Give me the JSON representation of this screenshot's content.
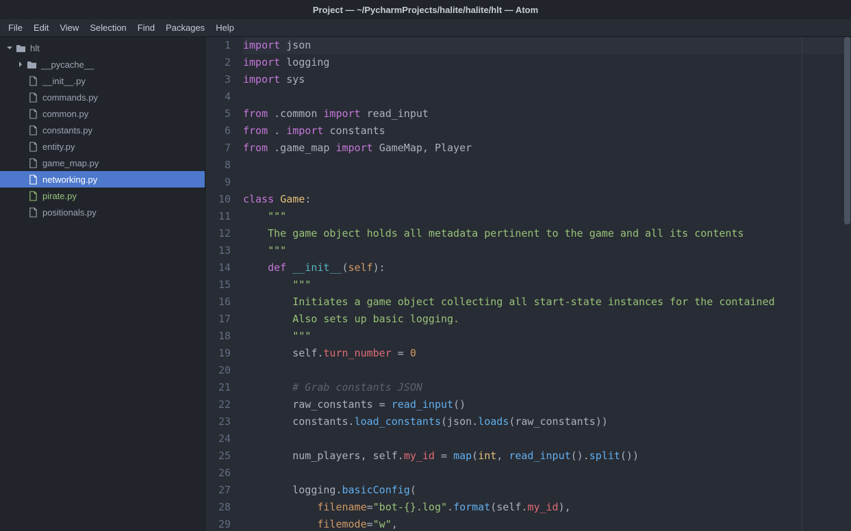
{
  "window": {
    "title": "Project — ~/PycharmProjects/halite/halite/hlt — Atom"
  },
  "menu": {
    "items": [
      "File",
      "Edit",
      "View",
      "Selection",
      "Find",
      "Packages",
      "Help"
    ]
  },
  "tree": {
    "root": {
      "name": "hlt"
    },
    "folder_pycache": {
      "name": "__pycache__"
    },
    "files": [
      {
        "name": "__init__.py"
      },
      {
        "name": "commands.py"
      },
      {
        "name": "common.py"
      },
      {
        "name": "constants.py"
      },
      {
        "name": "entity.py"
      },
      {
        "name": "game_map.py"
      },
      {
        "name": "networking.py",
        "selected": true
      },
      {
        "name": "pirate.py",
        "modified": true
      },
      {
        "name": "positionals.py"
      }
    ]
  },
  "editor": {
    "line_count": 29,
    "current_line": 1,
    "wrap_column": 80,
    "scrollbar": {
      "top_pct": 0,
      "height_pct": 38
    }
  },
  "code": {
    "l1": [
      {
        "t": "import ",
        "c": "tok-import"
      },
      {
        "t": "json",
        "c": "tok-module"
      }
    ],
    "l2": [
      {
        "t": "import ",
        "c": "tok-import"
      },
      {
        "t": "logging",
        "c": "tok-module"
      }
    ],
    "l3": [
      {
        "t": "import ",
        "c": "tok-import"
      },
      {
        "t": "sys",
        "c": "tok-module"
      }
    ],
    "l4": [],
    "l5": [
      {
        "t": "from ",
        "c": "tok-import"
      },
      {
        "t": ".common ",
        "c": "tok-module"
      },
      {
        "t": "import ",
        "c": "tok-import"
      },
      {
        "t": "read_input",
        "c": "tok-module"
      }
    ],
    "l6": [
      {
        "t": "from ",
        "c": "tok-import"
      },
      {
        "t": ". ",
        "c": "tok-module"
      },
      {
        "t": "import ",
        "c": "tok-import"
      },
      {
        "t": "constants",
        "c": "tok-module"
      }
    ],
    "l7": [
      {
        "t": "from ",
        "c": "tok-import"
      },
      {
        "t": ".game_map ",
        "c": "tok-module"
      },
      {
        "t": "import ",
        "c": "tok-import"
      },
      {
        "t": "GameMap, Player",
        "c": "tok-module"
      }
    ],
    "l8": [],
    "l9": [],
    "l10": [
      {
        "t": "class ",
        "c": "tok-keyword"
      },
      {
        "t": "Game",
        "c": "tok-class"
      },
      {
        "t": ":",
        "c": "tok-punct"
      }
    ],
    "l11": [
      {
        "t": "    ",
        "c": ""
      },
      {
        "t": "\"\"\"",
        "c": "tok-string"
      }
    ],
    "l12": [
      {
        "t": "    The game object holds all metadata pertinent to the game and all its contents",
        "c": "tok-string"
      }
    ],
    "l13": [
      {
        "t": "    ",
        "c": ""
      },
      {
        "t": "\"\"\"",
        "c": "tok-string"
      }
    ],
    "l14": [
      {
        "t": "    ",
        "c": ""
      },
      {
        "t": "def ",
        "c": "tok-def"
      },
      {
        "t": "__init__",
        "c": "tok-magic"
      },
      {
        "t": "(",
        "c": "tok-paren"
      },
      {
        "t": "self",
        "c": "tok-param"
      },
      {
        "t": "):",
        "c": "tok-paren"
      }
    ],
    "l15": [
      {
        "t": "        ",
        "c": ""
      },
      {
        "t": "\"\"\"",
        "c": "tok-string"
      }
    ],
    "l16": [
      {
        "t": "        Initiates a game object collecting all start-state instances for the contained",
        "c": "tok-string"
      }
    ],
    "l17": [
      {
        "t": "        Also sets up basic logging.",
        "c": "tok-string"
      }
    ],
    "l18": [
      {
        "t": "        ",
        "c": ""
      },
      {
        "t": "\"\"\"",
        "c": "tok-string"
      }
    ],
    "l19": [
      {
        "t": "        self",
        "c": "tok-self"
      },
      {
        "t": ".",
        "c": "tok-punct"
      },
      {
        "t": "turn_number",
        "c": "tok-attr"
      },
      {
        "t": " = ",
        "c": "tok-punct"
      },
      {
        "t": "0",
        "c": "tok-num"
      }
    ],
    "l20": [],
    "l21": [
      {
        "t": "        ",
        "c": ""
      },
      {
        "t": "# Grab constants JSON",
        "c": "tok-comment"
      }
    ],
    "l22": [
      {
        "t": "        raw_constants = ",
        "c": "tok-self"
      },
      {
        "t": "read_input",
        "c": "tok-call"
      },
      {
        "t": "()",
        "c": "tok-paren"
      }
    ],
    "l23": [
      {
        "t": "        constants.",
        "c": "tok-self"
      },
      {
        "t": "load_constants",
        "c": "tok-call"
      },
      {
        "t": "(",
        "c": "tok-paren"
      },
      {
        "t": "json.",
        "c": "tok-self"
      },
      {
        "t": "loads",
        "c": "tok-call"
      },
      {
        "t": "(",
        "c": "tok-paren"
      },
      {
        "t": "raw_constants",
        "c": "tok-self"
      },
      {
        "t": "))",
        "c": "tok-paren"
      }
    ],
    "l24": [],
    "l25": [
      {
        "t": "        num_players, self.",
        "c": "tok-self"
      },
      {
        "t": "my_id",
        "c": "tok-attr"
      },
      {
        "t": " = ",
        "c": "tok-punct"
      },
      {
        "t": "map",
        "c": "tok-call"
      },
      {
        "t": "(",
        "c": "tok-paren"
      },
      {
        "t": "int",
        "c": "tok-builtin"
      },
      {
        "t": ", ",
        "c": "tok-punct"
      },
      {
        "t": "read_input",
        "c": "tok-call"
      },
      {
        "t": "().",
        "c": "tok-paren"
      },
      {
        "t": "split",
        "c": "tok-call"
      },
      {
        "t": "())",
        "c": "tok-paren"
      }
    ],
    "l26": [],
    "l27": [
      {
        "t": "        logging.",
        "c": "tok-self"
      },
      {
        "t": "basicConfig",
        "c": "tok-call"
      },
      {
        "t": "(",
        "c": "tok-paren"
      }
    ],
    "l28": [
      {
        "t": "            ",
        "c": ""
      },
      {
        "t": "filename",
        "c": "tok-param"
      },
      {
        "t": "=",
        "c": "tok-punct"
      },
      {
        "t": "\"bot-{}.log\"",
        "c": "tok-string"
      },
      {
        "t": ".",
        "c": "tok-punct"
      },
      {
        "t": "format",
        "c": "tok-call"
      },
      {
        "t": "(",
        "c": "tok-paren"
      },
      {
        "t": "self.",
        "c": "tok-self"
      },
      {
        "t": "my_id",
        "c": "tok-attr"
      },
      {
        "t": "),",
        "c": "tok-paren"
      }
    ],
    "l29": [
      {
        "t": "            ",
        "c": ""
      },
      {
        "t": "filemode",
        "c": "tok-param"
      },
      {
        "t": "=",
        "c": "tok-punct"
      },
      {
        "t": "\"w\"",
        "c": "tok-string"
      },
      {
        "t": ",",
        "c": "tok-punct"
      }
    ]
  }
}
